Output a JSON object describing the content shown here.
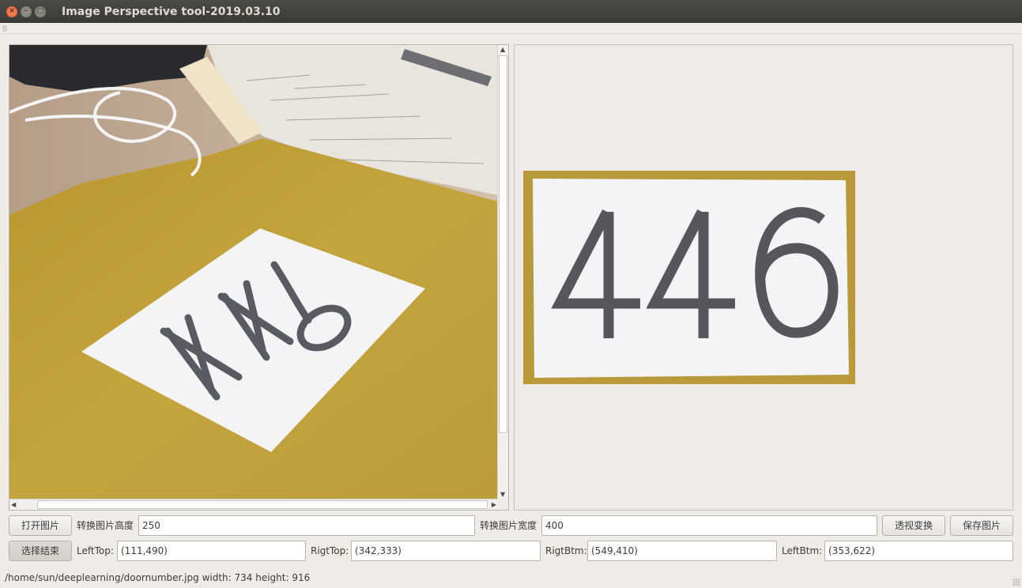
{
  "window": {
    "title": "Image Perspective tool-2019.03.10",
    "close_glyph": "×",
    "min_glyph": "–",
    "max_glyph": "□"
  },
  "source_image": {
    "icon": "source-photo",
    "number_text": "446"
  },
  "result_image": {
    "icon": "transformed-photo",
    "number_text": "446"
  },
  "controls": {
    "open_button": "打开图片",
    "height_label": "转换图片高度",
    "height_value": "250",
    "width_label": "转换图片宽度",
    "width_value": "400",
    "transform_button": "透视变换",
    "save_button": "保存图片",
    "select_done_button": "选择结束",
    "lefttop_label": "LeftTop:",
    "lefttop_value": "(111,490)",
    "rigttop_label": "RigtTop:",
    "rigttop_value": "(342,333)",
    "rigtbtm_label": "RigtBtm:",
    "rigtbtm_value": "(549,410)",
    "leftbtm_label": "LeftBtm:",
    "leftbtm_value": "(353,622)"
  },
  "status": {
    "text": "/home/sun/deeplearning/doornumber.jpg width: 734 height: 916"
  },
  "colors": {
    "titlebar": "#3b3a36",
    "window_bg": "#efebe7",
    "folder_yellow": "#c2a23a",
    "paper_white": "#f4f4f6",
    "digit_gray": "#56565c"
  }
}
